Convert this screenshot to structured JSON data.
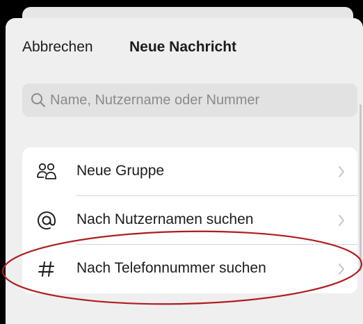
{
  "header": {
    "cancel_label": "Abbrechen",
    "title": "Neue Nachricht"
  },
  "search": {
    "placeholder": "Name, Nutzername oder Nummer",
    "icon": "search-icon"
  },
  "options": [
    {
      "label": "Neue Gruppe",
      "icon": "people-icon"
    },
    {
      "label": "Nach Nutzernamen suchen",
      "icon": "at-sign-icon"
    },
    {
      "label": "Nach Telefonnummer suchen",
      "icon": "hash-icon"
    }
  ],
  "colors": {
    "sheet_background": "#efefef",
    "card_background": "#ffffff",
    "text": "#1c1c1e",
    "placeholder": "#8a8a8e",
    "annotation_circle": "#b01c1c"
  }
}
